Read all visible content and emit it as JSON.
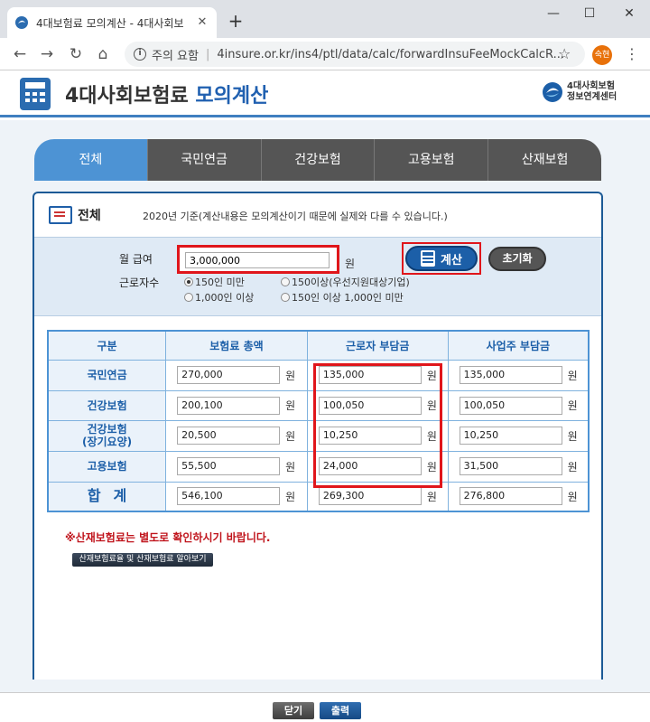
{
  "browser": {
    "tab_title": "4대보험료 모의계산 - 4대사회보",
    "new_tab": "+",
    "minimize": "—",
    "maximize": "☐",
    "close": "✕",
    "security_label": "주의 요함",
    "url": "4insure.or.kr/ins4/ptl/data/calc/forwardInsuFeeMockCalcR...",
    "profile_initial": "숙현"
  },
  "header": {
    "title_prefix": "4대사회보험료",
    "title_highlight": "모의계산",
    "org_line1": "4대사회보험",
    "org_line2": "정보연계센터"
  },
  "tabs": [
    "전체",
    "국민연금",
    "건강보험",
    "고용보험",
    "산재보험"
  ],
  "section": {
    "title": "전체",
    "note": "2020년 기준(계산내용은 모의계산이기 때문에 실제와 다를 수 있습니다.)"
  },
  "form": {
    "salary_label": "월 급여",
    "salary_value": "3,000,000",
    "unit": "원",
    "workers_label": "근로자수",
    "options": [
      {
        "label": "150인 미만",
        "checked": true
      },
      {
        "label": "150이상(우선지원대상기업)",
        "checked": false
      },
      {
        "label": "1,000인 이상",
        "checked": false
      },
      {
        "label": "150인 이상 1,000인 미만",
        "checked": false
      }
    ],
    "calc_button": "계산",
    "reset_button": "초기화"
  },
  "table": {
    "headers": [
      "구분",
      "보험료 총액",
      "근로자 부담금",
      "사업주 부담금"
    ],
    "rows": [
      {
        "category": "국민연금",
        "category2": "",
        "total": "270,000",
        "employee": "135,000",
        "employer": "135,000"
      },
      {
        "category": "건강보험",
        "category2": "",
        "total": "200,100",
        "employee": "100,050",
        "employer": "100,050"
      },
      {
        "category": "건강보험",
        "category2": "(장기요양)",
        "total": "20,500",
        "employee": "10,250",
        "employer": "10,250"
      },
      {
        "category": "고용보험",
        "category2": "",
        "total": "55,500",
        "employee": "24,000",
        "employer": "31,500"
      }
    ],
    "sum_label": "합계",
    "sum": {
      "total": "546,100",
      "employee": "269,300",
      "employer": "276,800"
    },
    "unit": "원"
  },
  "notice": "※산재보험료는 별도로 확인하시기 바랍니다.",
  "link_button": "산재보험료율 및 산재보험료 알아보기",
  "footer": {
    "close_button": "닫기",
    "print_button": "출력"
  },
  "colors": {
    "accent": "#1c5fa8",
    "highlight": "#e0161b",
    "tab_active": "#4d93d4",
    "tab_inactive": "#555555",
    "warning": "#c0141c"
  }
}
